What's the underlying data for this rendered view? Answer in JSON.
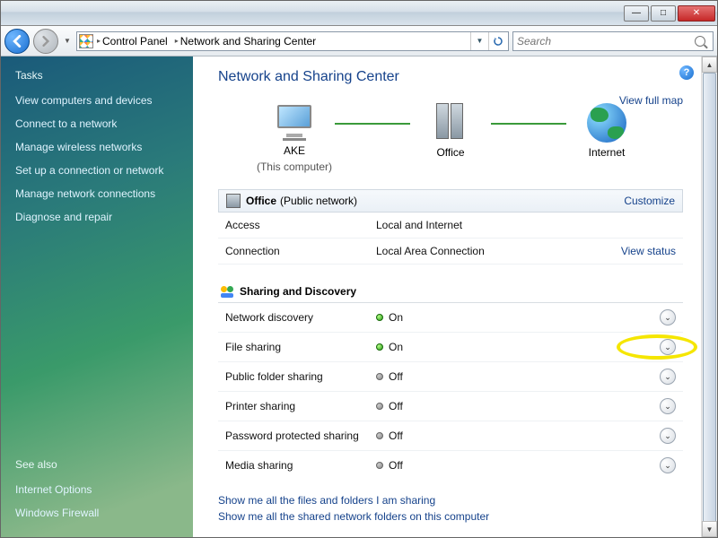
{
  "titlebar": {},
  "nav": {},
  "addressbar": {
    "seg1": "Control Panel",
    "seg2": "Network and Sharing Center"
  },
  "search": {
    "placeholder": "Search"
  },
  "sidebar": {
    "tasks_title": "Tasks",
    "tasks": {
      "t0": "View computers and devices",
      "t1": "Connect to a network",
      "t2": "Manage wireless networks",
      "t3": "Set up a connection or network",
      "t4": "Manage network connections",
      "t5": "Diagnose and repair"
    },
    "seealso_title": "See also",
    "seealso": {
      "s0": "Internet Options",
      "s1": "Windows Firewall"
    }
  },
  "page": {
    "title": "Network and Sharing Center",
    "view_full_map": "View full map",
    "nodes": {
      "pc": "AKE",
      "pc_sub": "(This computer)",
      "net": "Office",
      "internet": "Internet"
    },
    "network": {
      "name": "Office",
      "type": "(Public network)",
      "customize": "Customize",
      "access_k": "Access",
      "access_v": "Local and Internet",
      "conn_k": "Connection",
      "conn_v": "Local Area Connection",
      "view_status": "View status"
    },
    "sharing": {
      "title": "Sharing and Discovery",
      "r0k": "Network discovery",
      "r0v": "On",
      "r0s": "on",
      "r1k": "File sharing",
      "r1v": "On",
      "r1s": "on",
      "r2k": "Public folder sharing",
      "r2v": "Off",
      "r2s": "off",
      "r3k": "Printer sharing",
      "r3v": "Off",
      "r3s": "off",
      "r4k": "Password protected sharing",
      "r4v": "Off",
      "r4s": "off",
      "r5k": "Media sharing",
      "r5v": "Off",
      "r5s": "off"
    },
    "links": {
      "l0": "Show me all the files and folders I am sharing",
      "l1": "Show me all the shared network folders on this computer"
    }
  }
}
